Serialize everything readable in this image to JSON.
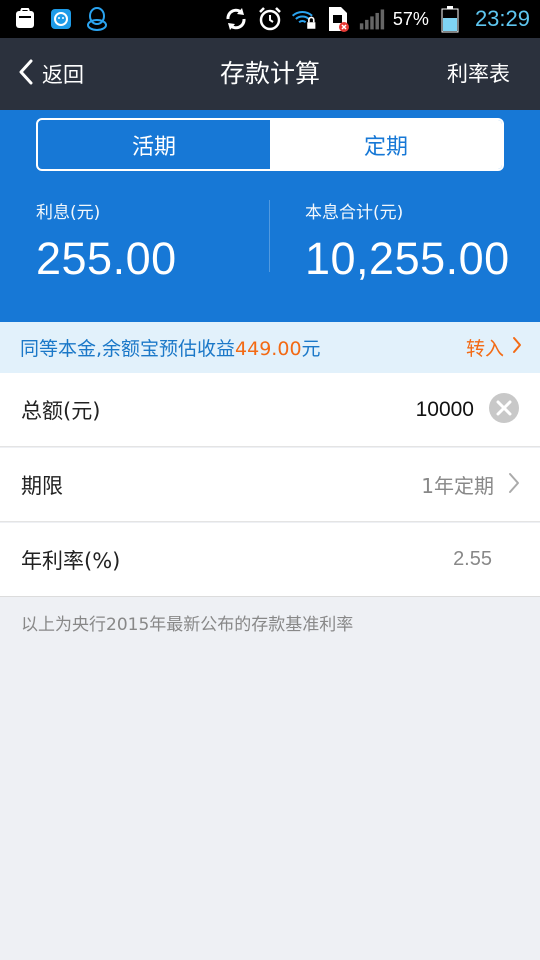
{
  "status_bar": {
    "battery_percent": "57%",
    "time": "23:29",
    "icons": [
      "store-icon",
      "message-app-icon",
      "qq-penguin-icon",
      "sync-icon",
      "alarm-icon",
      "wifi-lock-icon",
      "sim-error-icon",
      "signal-bars-icon",
      "battery-icon"
    ]
  },
  "nav": {
    "back_label": "返回",
    "title": "存款计算",
    "right_label": "利率表"
  },
  "segment": {
    "options": [
      "活期",
      "定期"
    ],
    "selected": "定期"
  },
  "results": {
    "interest_label": "利息(元)",
    "interest_value": "255.00",
    "total_label": "本息合计(元)",
    "total_value": "10,255.00"
  },
  "promo": {
    "text_prefix": "同等本金,余额宝预估收益",
    "amount": "449.00",
    "text_suffix": "元",
    "link_label": "转入"
  },
  "form": {
    "amount_label": "总额(元)",
    "amount_value": "10000",
    "term_label": "期限",
    "term_value": "1年定期",
    "rate_label": "年利率(%)",
    "rate_value": "2.55"
  },
  "footnote": "以上为央行2015年最新公布的存款基准利率",
  "colors": {
    "primary_blue": "#1778d6",
    "nav_dark": "#2b313d",
    "accent_orange": "#f36a14",
    "clock_cyan": "#5ec6f0"
  }
}
